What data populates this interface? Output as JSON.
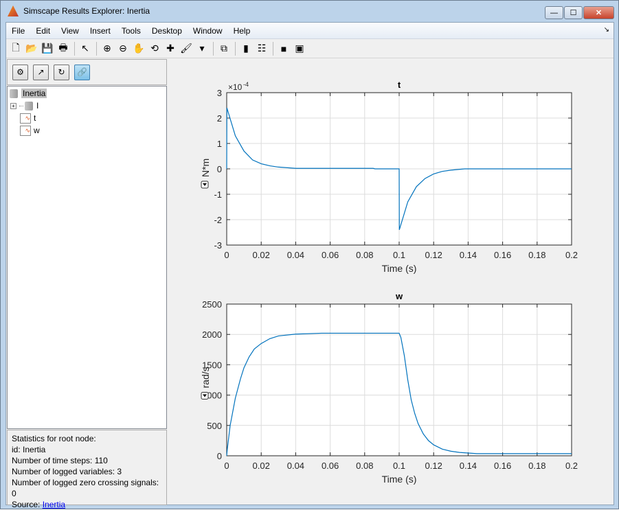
{
  "window": {
    "title": "Simscape Results Explorer: Inertia",
    "buttons": {
      "minimize": "—",
      "maximize": "☐",
      "close": "✕"
    }
  },
  "menu": [
    "File",
    "Edit",
    "View",
    "Insert",
    "Tools",
    "Desktop",
    "Window",
    "Help"
  ],
  "menu_dock_icon": "↘",
  "toolbar": [
    {
      "name": "new-figure",
      "glyph": "🗋"
    },
    {
      "name": "open",
      "glyph": "📂"
    },
    {
      "name": "save",
      "glyph": "💾"
    },
    {
      "name": "print",
      "glyph": "🖶"
    },
    {
      "sep": true
    },
    {
      "name": "pointer",
      "glyph": "↖"
    },
    {
      "sep": true
    },
    {
      "name": "zoom-in",
      "glyph": "⊕"
    },
    {
      "name": "zoom-out",
      "glyph": "⊖"
    },
    {
      "name": "pan",
      "glyph": "✋"
    },
    {
      "name": "rotate-3d",
      "glyph": "⟲"
    },
    {
      "name": "data-cursor",
      "glyph": "✚"
    },
    {
      "name": "brush",
      "glyph": "🖌"
    },
    {
      "name": "brush-dropdown",
      "glyph": "▾"
    },
    {
      "sep": true
    },
    {
      "name": "link-plot",
      "glyph": "⧉"
    },
    {
      "sep": true
    },
    {
      "name": "colorbar",
      "glyph": "▮"
    },
    {
      "name": "legend",
      "glyph": "☷"
    },
    {
      "sep": true
    },
    {
      "name": "hide-plot-tools",
      "glyph": "■"
    },
    {
      "name": "show-plot-tools",
      "glyph": "▣"
    }
  ],
  "panel_buttons": [
    {
      "name": "options",
      "glyph": "⚙"
    },
    {
      "name": "plot-signal",
      "glyph": "↗"
    },
    {
      "name": "reload",
      "glyph": "↻"
    },
    {
      "name": "link",
      "glyph": "🔗",
      "active": true
    }
  ],
  "tree": {
    "root": "Inertia",
    "children": [
      {
        "label": "I",
        "type": "node",
        "expandable": true
      },
      {
        "label": "t",
        "type": "signal"
      },
      {
        "label": "w",
        "type": "signal"
      }
    ]
  },
  "stats": {
    "lines": [
      "Statistics for root node:",
      "id: Inertia",
      "Number of time steps: 110",
      "Number of logged variables: 3",
      "Number of logged zero crossing signals: 0"
    ],
    "source_label": "Source: ",
    "source_link": "Inertia"
  },
  "colors": {
    "line": "#0072bd",
    "grid": "#dcdcdc",
    "link": "#0000ee"
  },
  "chart_data": [
    {
      "type": "line",
      "title": "t",
      "xlabel": "Time (s)",
      "ylabel": "N*m",
      "xlim": [
        0,
        0.2
      ],
      "ylim": [
        -0.0003,
        0.0003
      ],
      "exponent_label": "×10",
      "exponent": "-4",
      "grid": true,
      "xticks": [
        "0",
        "0.02",
        "0.04",
        "0.06",
        "0.08",
        "0.1",
        "0.12",
        "0.14",
        "0.16",
        "0.18",
        "0.2"
      ],
      "yticks": [
        "-3",
        "-2",
        "-1",
        "0",
        "1",
        "2",
        "3"
      ],
      "x": [
        0,
        0.0001,
        0.005,
        0.01,
        0.015,
        0.02,
        0.025,
        0.03,
        0.04,
        0.085,
        0.086,
        0.1,
        0.1001,
        0.105,
        0.11,
        0.115,
        0.12,
        0.125,
        0.13,
        0.138,
        0.2
      ],
      "y": [
        0,
        0.00024,
        0.00013,
        7e-05,
        3.5e-05,
        2e-05,
        1.2e-05,
        7e-06,
        2e-06,
        2e-06,
        0,
        0,
        -0.00024,
        -0.00013,
        -7e-05,
        -3.8e-05,
        -2e-05,
        -1e-05,
        -5e-06,
        0,
        0
      ]
    },
    {
      "type": "line",
      "title": "w",
      "xlabel": "Time (s)",
      "ylabel": "rad/s",
      "xlim": [
        0,
        0.2
      ],
      "ylim": [
        0,
        2500
      ],
      "grid": true,
      "xticks": [
        "0",
        "0.02",
        "0.04",
        "0.06",
        "0.08",
        "0.1",
        "0.12",
        "0.14",
        "0.16",
        "0.18",
        "0.2"
      ],
      "yticks": [
        "0",
        "500",
        "1000",
        "1500",
        "2000",
        "2500"
      ],
      "x": [
        0,
        0.0003,
        0.002,
        0.005,
        0.008,
        0.01,
        0.013,
        0.016,
        0.02,
        0.025,
        0.03,
        0.04,
        0.055,
        0.1,
        0.101,
        0.103,
        0.105,
        0.107,
        0.109,
        0.111,
        0.114,
        0.117,
        0.12,
        0.125,
        0.13,
        0.135,
        0.14,
        0.145,
        0.2
      ],
      "y": [
        0,
        100,
        500,
        950,
        1270,
        1450,
        1630,
        1760,
        1850,
        1930,
        1975,
        2005,
        2020,
        2020,
        1950,
        1650,
        1250,
        920,
        700,
        530,
        360,
        250,
        180,
        110,
        75,
        55,
        45,
        35,
        35
      ]
    }
  ]
}
